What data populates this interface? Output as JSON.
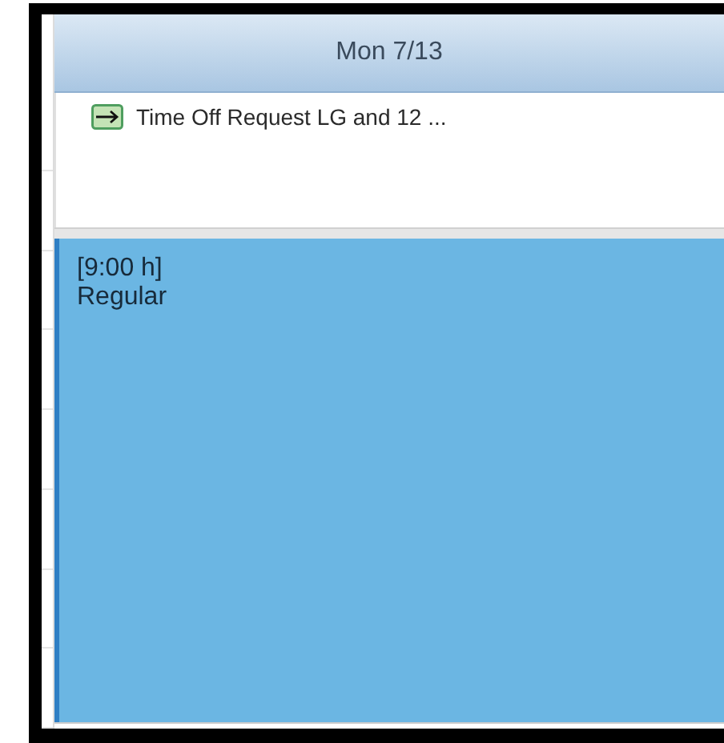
{
  "day_header": "Mon 7/13",
  "all_day_events": [
    {
      "title": "Time Off Request LG and 12 ..."
    }
  ],
  "appointments": [
    {
      "duration": "[9:00 h]",
      "type": "Regular"
    }
  ]
}
